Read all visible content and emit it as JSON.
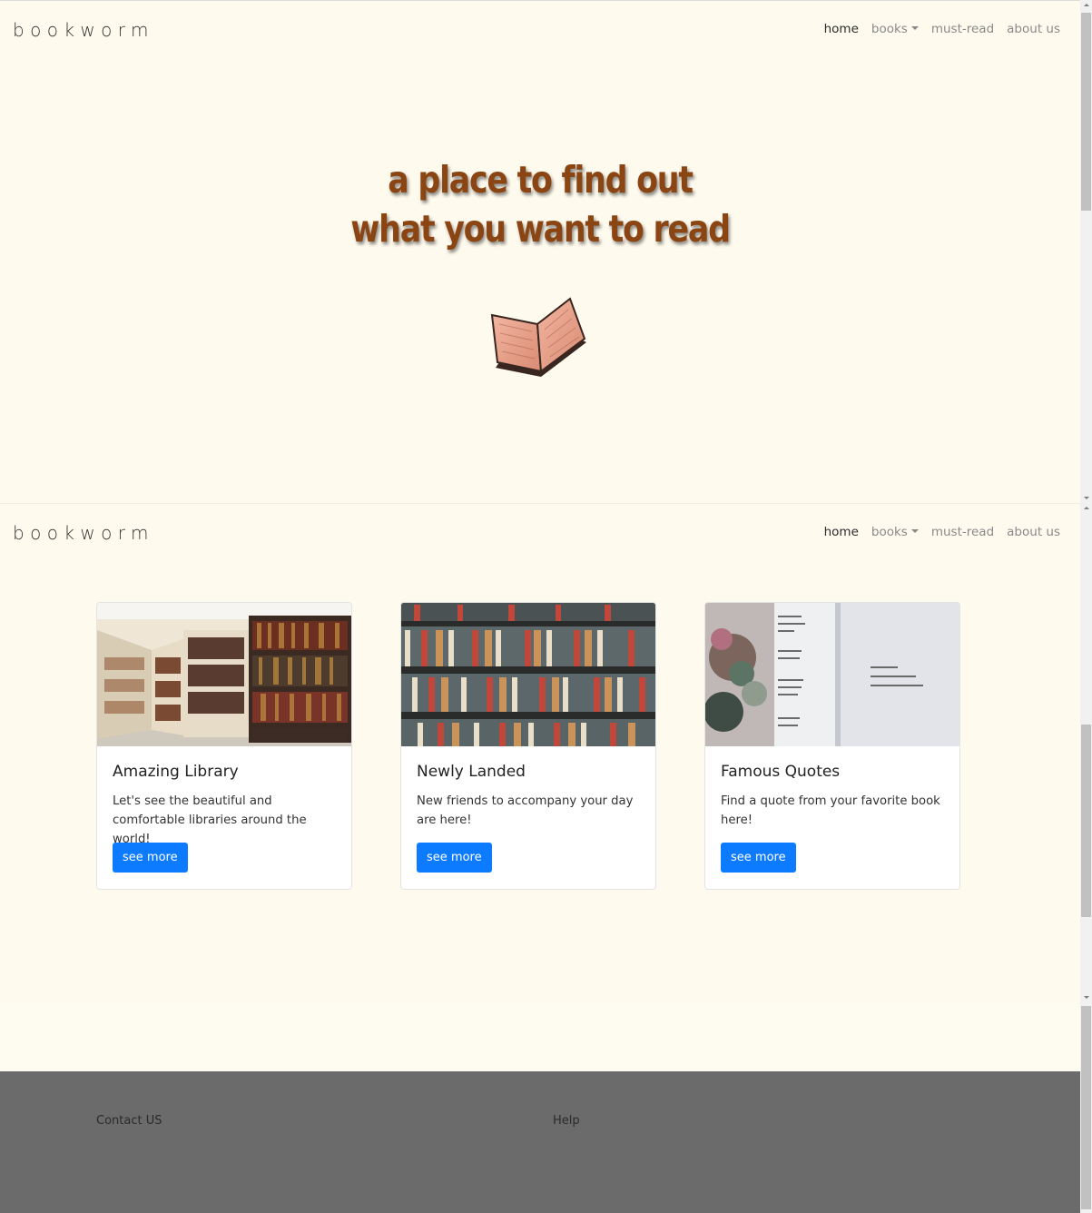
{
  "brand": "bookworm",
  "nav": {
    "home": "home",
    "books": "books",
    "must_read": "must-read",
    "about_us": "about us"
  },
  "hero": {
    "line1": "a place to find out",
    "line2": "what you want to read"
  },
  "cards": [
    {
      "title": "Amazing Library",
      "text": "Let's see the beautiful and comfortable libraries around the world!",
      "button": "see more"
    },
    {
      "title": "Newly Landed",
      "text": "New friends to accompany your day are here!",
      "button": "see more"
    },
    {
      "title": "Famous Quotes",
      "text": "Find a quote from your favorite book here!",
      "button": "see more"
    }
  ],
  "footer": {
    "contact": "Contact US",
    "help": "Help"
  },
  "colors": {
    "background": "#fefaee",
    "hero_text": "#8b4513",
    "button": "#0d7bff",
    "footer": "#6b6b6b"
  }
}
